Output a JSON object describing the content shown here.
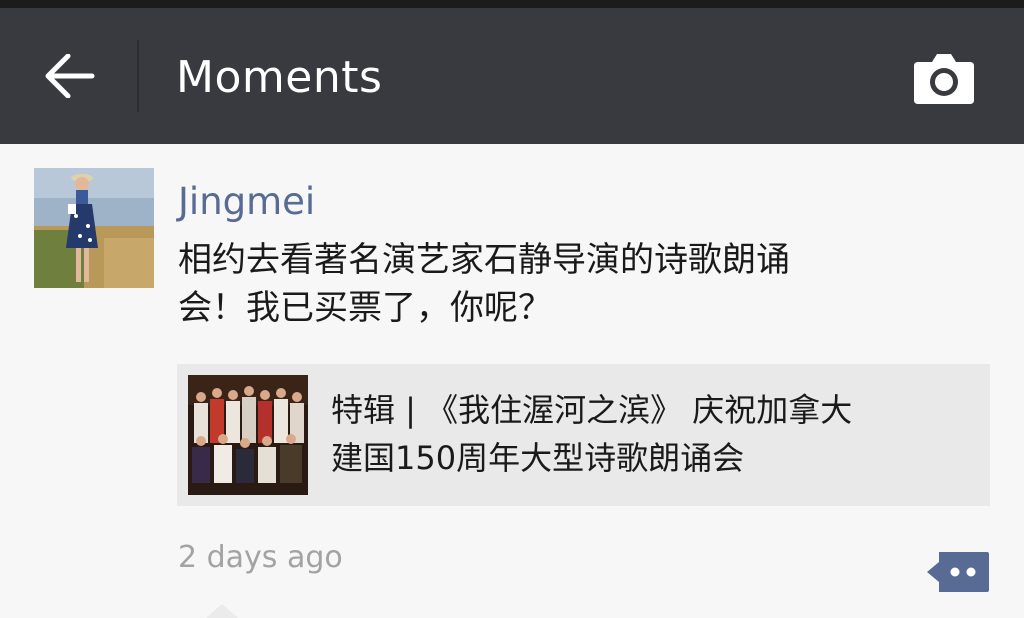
{
  "header": {
    "title": "Moments",
    "back_icon": "back-arrow-icon",
    "camera_icon": "camera-icon"
  },
  "post": {
    "username": "Jingmei",
    "text": "相约去看著名演艺家石静导演的诗歌朗诵\n会！我已买票了，你呢？",
    "link": {
      "title": "特辑 | 《我住渥河之滨》 庆祝加拿大\n建国150周年大型诗歌朗诵会"
    },
    "timestamp": "2 days ago",
    "comment_icon": "comment-bubble-icon"
  },
  "colors": {
    "appbar": "#393a3f",
    "username": "#576b95",
    "background": "#f7f7f7",
    "link_card": "#e9e9e9",
    "comment_button": "#576b95"
  }
}
